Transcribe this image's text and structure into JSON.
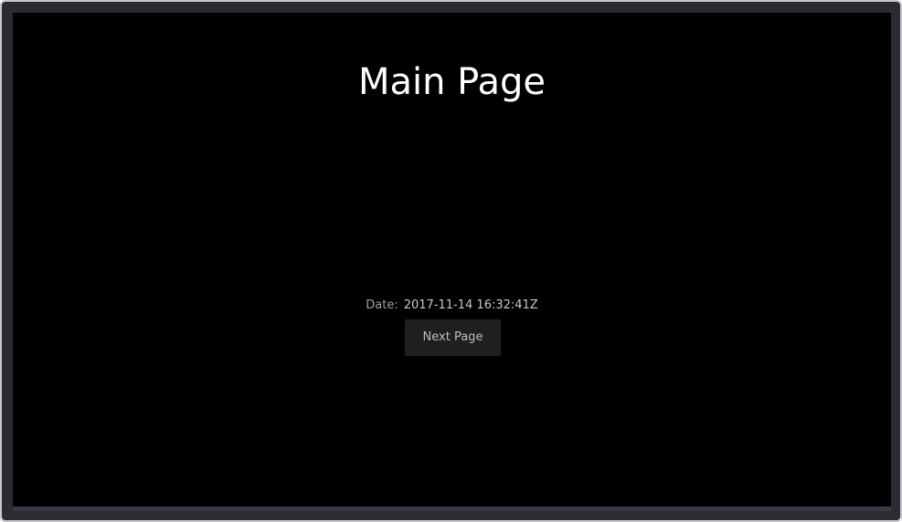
{
  "page": {
    "title": "Main Page"
  },
  "date": {
    "label": "Date:",
    "value": "2017-11-14 16:32:41Z"
  },
  "actions": {
    "next_label": "Next Page"
  },
  "colors": {
    "background": "#000000",
    "frame": "#2b2c33",
    "button": "#1f1f1f",
    "title_text": "#ffffff"
  }
}
